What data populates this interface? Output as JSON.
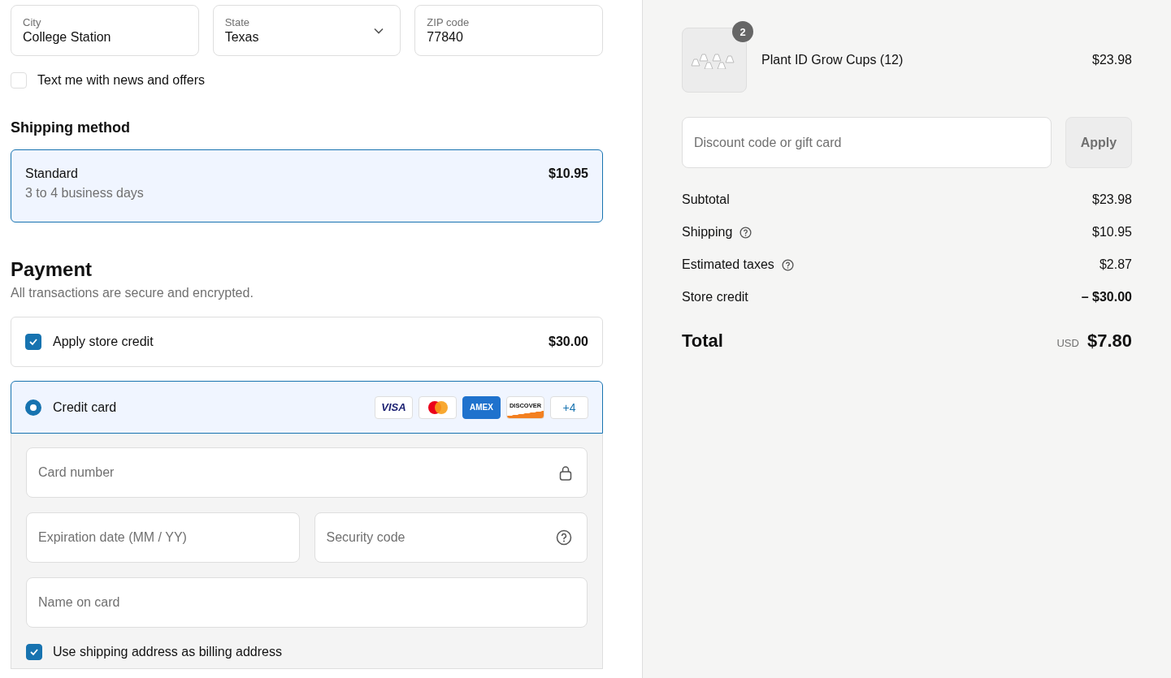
{
  "address": [
    {
      "label": "City",
      "value": "College Station",
      "kind": "text"
    },
    {
      "label": "State",
      "value": "Texas",
      "kind": "select"
    },
    {
      "label": "ZIP code",
      "value": "77840",
      "kind": "text"
    }
  ],
  "sms_opt_in": {
    "label": "Text me with news and offers",
    "checked": false
  },
  "shipping": {
    "heading": "Shipping method",
    "options": [
      {
        "name": "Standard",
        "detail": "3 to 4 business days",
        "price": "$10.95",
        "selected": true
      }
    ]
  },
  "payment": {
    "heading": "Payment",
    "subtitle": "All transactions are secure and encrypted.",
    "store_credit": {
      "label": "Apply store credit",
      "amount": "$30.00",
      "checked": true
    },
    "methods": [
      {
        "label": "Credit card",
        "selected": true,
        "brands": [
          {
            "kind": "visa",
            "text": "VISA"
          },
          {
            "kind": "mastercard"
          },
          {
            "kind": "amex",
            "text": "AMEX"
          },
          {
            "kind": "discover",
            "text": "DISCOVER"
          },
          {
            "kind": "more",
            "text": "+4"
          }
        ]
      }
    ],
    "card_fields": [
      {
        "placeholder": "Card number",
        "kind": "card_number"
      },
      {
        "placeholder": "Expiration date (MM / YY)",
        "kind": "expiry"
      },
      {
        "placeholder": "Security code",
        "kind": "security_code"
      },
      {
        "placeholder": "Name on card",
        "kind": "name"
      }
    ],
    "billing_same": {
      "label": "Use shipping address as billing address",
      "checked": true
    }
  },
  "summary": {
    "item": {
      "name": "Plant ID Grow Cups (12)",
      "price": "$23.98",
      "quantity": "2"
    },
    "discount": {
      "placeholder": "Discount code or gift card",
      "button": "Apply"
    },
    "lines": [
      {
        "label": "Subtotal",
        "value": "$23.98",
        "kind": "plain"
      },
      {
        "label": "Shipping",
        "value": "$10.95",
        "kind": "with_help"
      },
      {
        "label": "Estimated taxes",
        "value": "$2.87",
        "kind": "with_help"
      },
      {
        "label": "Store credit",
        "value": "– $30.00",
        "kind": "credit"
      }
    ],
    "total": {
      "label": "Total",
      "currency": "USD",
      "value": "$7.80"
    }
  }
}
